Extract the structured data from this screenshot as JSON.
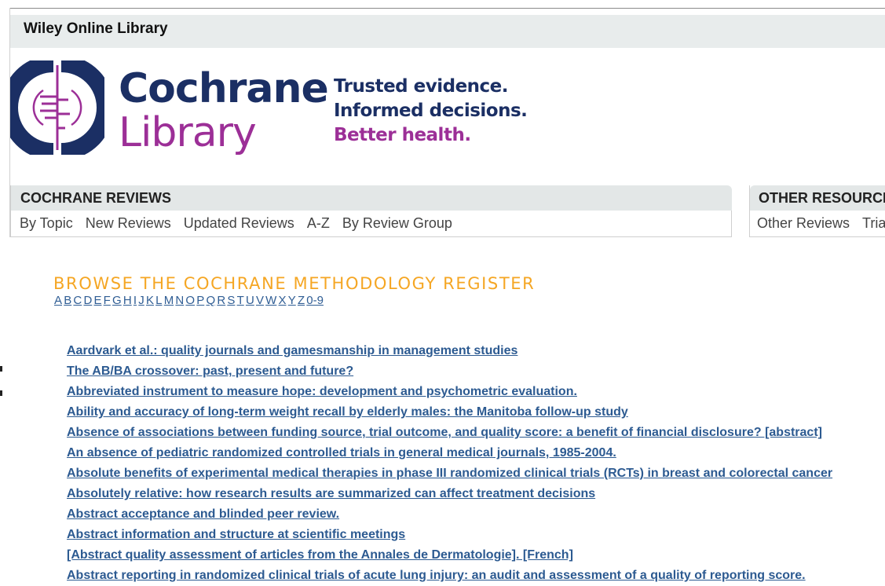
{
  "header": {
    "wiley_label": "Wiley Online Library"
  },
  "brand": {
    "name_line1": "Cochrane",
    "name_line2": "Library",
    "tagline": [
      "Trusted evidence.",
      "Informed decisions.",
      "Better health."
    ],
    "colors": {
      "navy": "#1b2f64",
      "purple": "#9c2f97"
    }
  },
  "nav": {
    "reviews_title": "COCHRANE REVIEWS",
    "reviews_links": [
      "By Topic",
      "New Reviews",
      "Updated Reviews",
      "A-Z",
      "By Review Group"
    ],
    "other_title": "OTHER RESOURCES",
    "other_links": [
      "Other Reviews",
      "Trials"
    ]
  },
  "browse": {
    "title": "BROWSE THE COCHRANE METHODOLOGY REGISTER",
    "letters": [
      "A",
      "B",
      "C",
      "D",
      "E",
      "F",
      "G",
      "H",
      "I",
      "J",
      "K",
      "L",
      "M",
      "N",
      "O",
      "P",
      "Q",
      "R",
      "S",
      "T",
      "U",
      "V",
      "W",
      "X",
      "Y",
      "Z",
      "0-9"
    ],
    "accent_color": "#f5a623",
    "link_color": "#2c5a91"
  },
  "results": [
    "Aardvark et al.: quality journals and gamesmanship in management studies",
    "The AB/BA crossover: past, present and future?",
    "Abbreviated instrument to measure hope: development and psychometric evaluation.",
    "Ability and accuracy of long-term weight recall by elderly males: the Manitoba follow-up study",
    "Absence of associations between funding source, trial outcome, and quality score: a benefit of financial disclosure? [abstract]",
    "An absence of pediatric randomized controlled trials in general medical journals, 1985-2004.",
    "Absolute benefits of experimental medical therapies in phase III randomized clinical trials (RCTs) in breast and colorectal cancer",
    "Absolutely relative: how research results are summarized can affect treatment decisions",
    "Abstract acceptance and blinded peer review.",
    "Abstract information and structure at scientific meetings",
    "[Abstract quality assessment of articles from the Annales de Dermatologie]. [French]",
    "Abstract reporting in randomized clinical trials of acute lung injury: an audit and assessment of a quality of reporting score."
  ]
}
